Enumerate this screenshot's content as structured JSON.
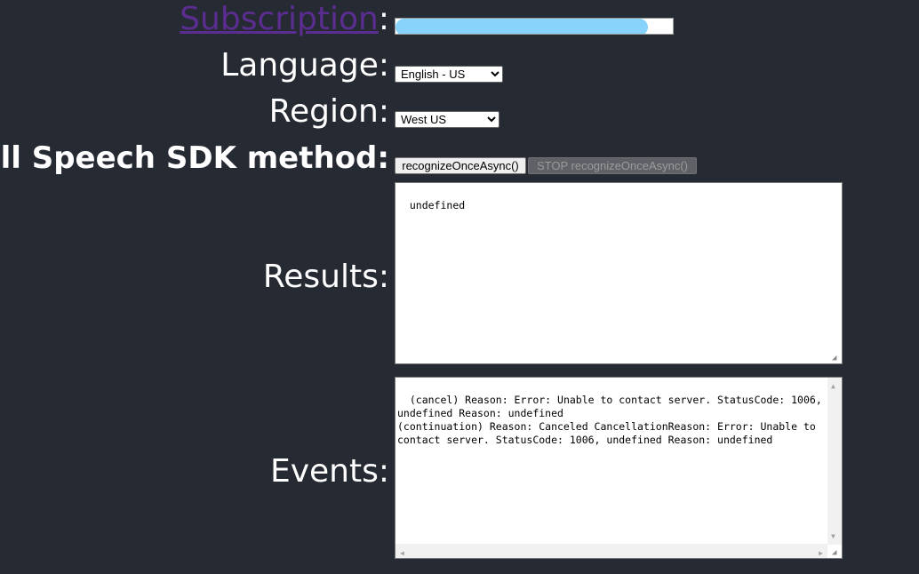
{
  "form": {
    "subscription_link": "Subscription",
    "colon": ":",
    "language_label": "Language:",
    "language_value": "English - US",
    "region_label": "Region:",
    "region_value": "West US",
    "method_label": "Call Speech SDK method:",
    "recognize_button": "recognizeOnceAsync()",
    "stop_button": "STOP recognizeOnceAsync()",
    "results_label": "Results:",
    "results_text": "undefined",
    "events_label": "Events:",
    "events_text": "(cancel) Reason: Error: Unable to contact server. StatusCode: 1006, undefined Reason: undefined\n(continuation) Reason: Canceled CancellationReason: Error: Unable to contact server. StatusCode: 1006, undefined Reason: undefined"
  },
  "colors": {
    "background": "#262a33",
    "link": "#5b2d91",
    "redaction": "#87d3fb"
  }
}
